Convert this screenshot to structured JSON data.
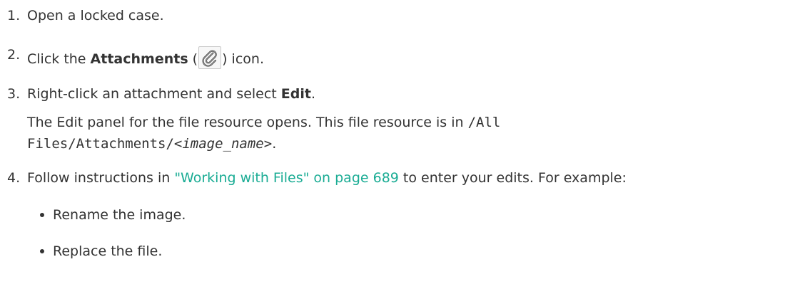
{
  "steps": [
    {
      "number": "1.",
      "text": "Open a locked case."
    },
    {
      "number": "2.",
      "before": "Click the ",
      "bold": "Attachments",
      "open_paren": " (",
      "icon": "paperclip-icon",
      "after": ") icon."
    },
    {
      "number": "3.",
      "before": "Right-click an attachment and select ",
      "bold": "Edit",
      "after": ".",
      "note": {
        "line1_text": "The Edit panel for the file resource opens. This file resource is in ",
        "line1_code": "/All",
        "line2_code": "Files/Attachments/<",
        "line2_code_italic": "image_name",
        "line2_code_end": ">",
        "line2_end": "."
      }
    },
    {
      "number": "4.",
      "before": "Follow instructions in ",
      "link": "\"Working with Files\" on page 689",
      "after": " to enter your edits. For example:",
      "bullets": [
        "Rename the image.",
        "Replace the file."
      ]
    }
  ],
  "colors": {
    "text": "#333333",
    "link": "#1aac94"
  }
}
